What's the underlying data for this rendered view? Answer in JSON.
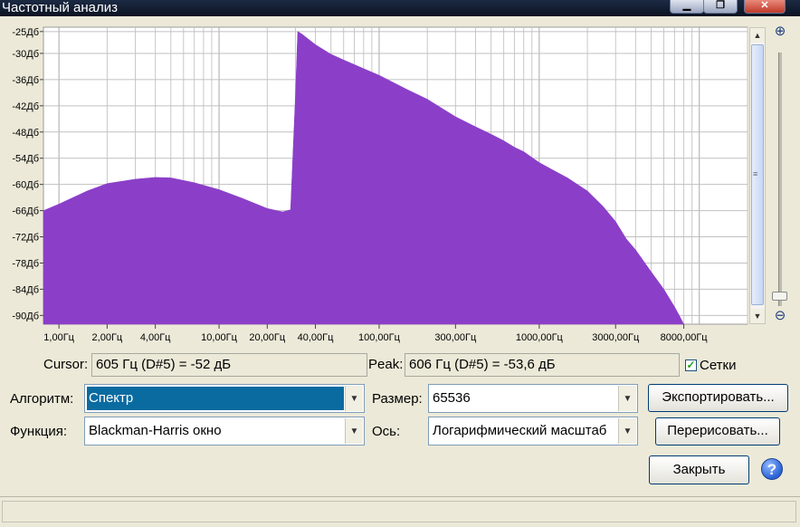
{
  "window": {
    "title": "Частотный анализ",
    "controls": {
      "minimize": "▁",
      "maximize": "❐",
      "close": "✕"
    }
  },
  "chart_data": {
    "type": "area",
    "x_scale": "log",
    "xlim": [
      0.8,
      20000
    ],
    "ylim": [
      -92,
      -24
    ],
    "grid": true,
    "y_ticks": [
      "-25Дб",
      "-30Дб",
      "-36Дб",
      "-42Дб",
      "-48Дб",
      "-54Дб",
      "-60Дб",
      "-66Дб",
      "-72Дб",
      "-78Дб",
      "-84Дб",
      "-90Дб"
    ],
    "x_ticks": [
      {
        "label": "1,00Гц",
        "value": 1
      },
      {
        "label": "2,00Гц",
        "value": 2
      },
      {
        "label": "4,00Гц",
        "value": 4
      },
      {
        "label": "10,00Гц",
        "value": 10
      },
      {
        "label": "20,00Гц",
        "value": 20
      },
      {
        "label": "40,00Гц",
        "value": 40
      },
      {
        "label": "100,00Гц",
        "value": 100
      },
      {
        "label": "300,00Гц",
        "value": 300
      },
      {
        "label": "1000,00Гц",
        "value": 1000
      },
      {
        "label": "3000,00Гц",
        "value": 3000
      },
      {
        "label": "8000,00Гц",
        "value": 8000
      }
    ],
    "series": [
      {
        "color": "#8b3fc8",
        "points": [
          [
            0.8,
            -66
          ],
          [
            1,
            -64.5
          ],
          [
            1.5,
            -61.5
          ],
          [
            2,
            -59.8
          ],
          [
            3,
            -58.8
          ],
          [
            4,
            -58.4
          ],
          [
            5,
            -58.5
          ],
          [
            7,
            -59.6
          ],
          [
            10,
            -61.2
          ],
          [
            14,
            -63.2
          ],
          [
            20,
            -65.5
          ],
          [
            25,
            -66.3
          ],
          [
            28,
            -65.8
          ],
          [
            30,
            -40
          ],
          [
            31,
            -25
          ],
          [
            33,
            -25.6
          ],
          [
            40,
            -28
          ],
          [
            50,
            -30.2
          ],
          [
            60,
            -31.5
          ],
          [
            80,
            -33.5
          ],
          [
            100,
            -35
          ],
          [
            150,
            -38.3
          ],
          [
            200,
            -40.5
          ],
          [
            300,
            -44.5
          ],
          [
            400,
            -46.8
          ],
          [
            500,
            -48.5
          ],
          [
            600,
            -50
          ],
          [
            700,
            -51.5
          ],
          [
            800,
            -52.5
          ],
          [
            1000,
            -55
          ],
          [
            1200,
            -56.6
          ],
          [
            1500,
            -58.5
          ],
          [
            2000,
            -61.5
          ],
          [
            2500,
            -65
          ],
          [
            3000,
            -68.5
          ],
          [
            3500,
            -72.5
          ],
          [
            4000,
            -75
          ],
          [
            5000,
            -80
          ],
          [
            6000,
            -84
          ],
          [
            7000,
            -88
          ],
          [
            7500,
            -90
          ],
          [
            8000,
            -92
          ]
        ]
      }
    ]
  },
  "scrollbar": {
    "up_arrow": "▲",
    "down_arrow": "▼",
    "thumb_grip": "≡"
  },
  "zoom": {
    "zoom_in": "⊕",
    "zoom_out": "⊖"
  },
  "readouts": {
    "cursor_label": "Cursor:",
    "cursor_value": "605 Гц (D#5) = -52 дБ",
    "peak_label": "Peak:",
    "peak_value": "606 Гц (D#5) = -53,6 дБ",
    "grid_label": "Сетки",
    "grid_checked": "✓"
  },
  "controls": {
    "algorithm_label": "Алгоритм:",
    "algorithm_value": "Спектр",
    "size_label": "Размер:",
    "size_value": "65536",
    "function_label": "Функция:",
    "function_value": "Blackman-Harris окно",
    "axis_label": "Ось:",
    "axis_value": "Логарифмический масштаб",
    "dropdown_arrow": "▼"
  },
  "buttons": {
    "export": "Экспортировать...",
    "redraw": "Перерисовать...",
    "close": "Закрыть",
    "help": "?"
  }
}
